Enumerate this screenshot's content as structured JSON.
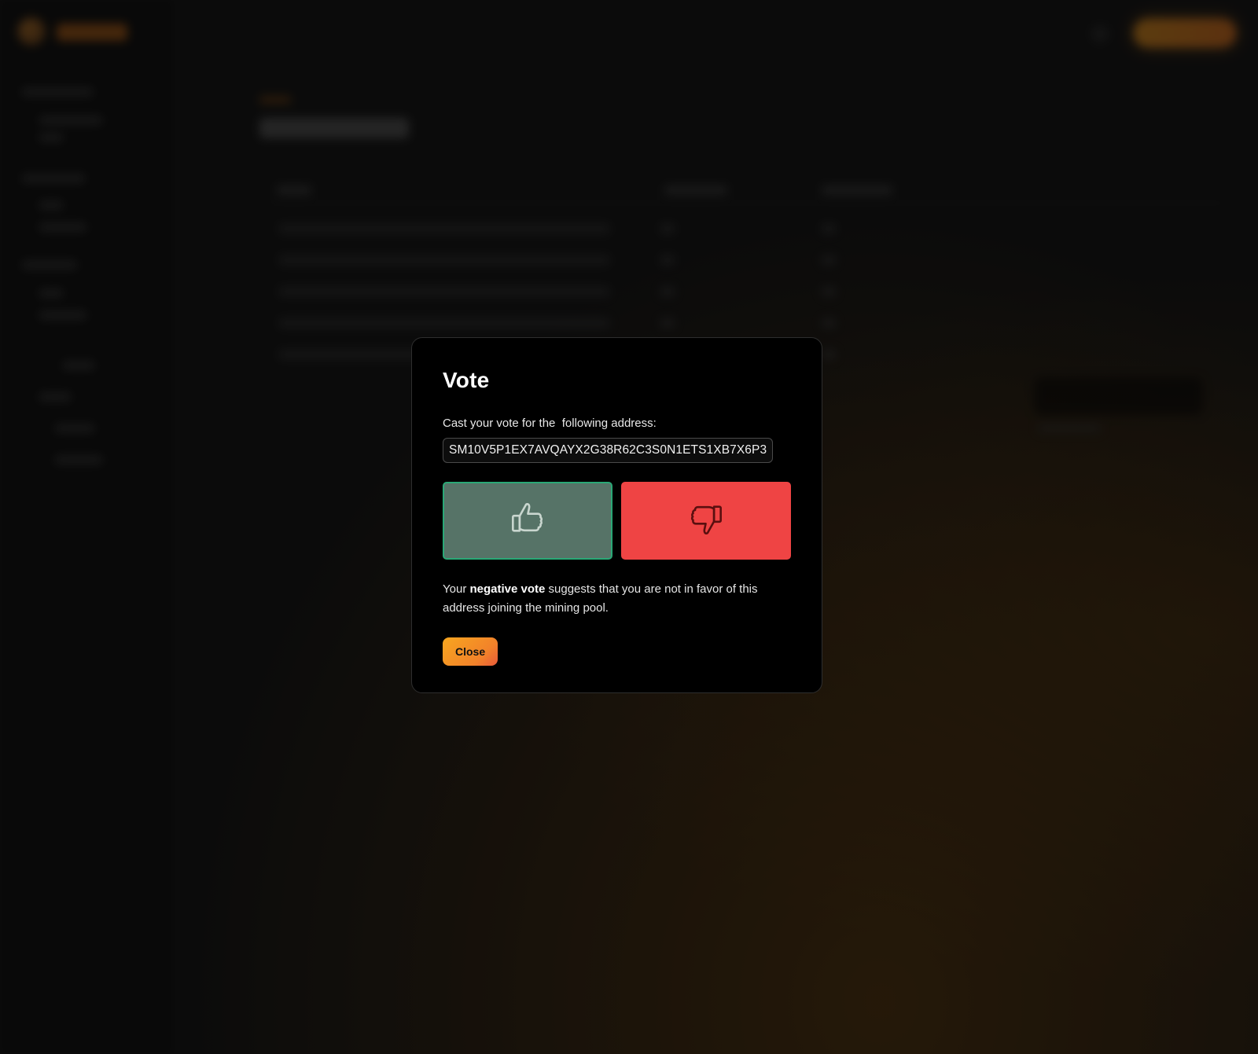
{
  "modal": {
    "title": "Vote",
    "label": "Cast your vote for the  following address:",
    "address": "SM10V5P1EX7AVQAYX2G38R62C3S0N1ETS1XB7X6P3",
    "explanation": {
      "prefix": "Your ",
      "emphasis": "negative vote",
      "suffix": " suggests that you are not in favor of this address joining the mining pool."
    },
    "close_label": "Close",
    "vote_up_icon": "thumbs-up-icon",
    "vote_down_icon": "thumbs-down-icon",
    "selected_vote": "negative"
  },
  "colors": {
    "accent": "#f7a61f",
    "vote_up_bg": "#567367",
    "vote_up_border": "#2aa876",
    "vote_down_bg": "#ef4444"
  }
}
